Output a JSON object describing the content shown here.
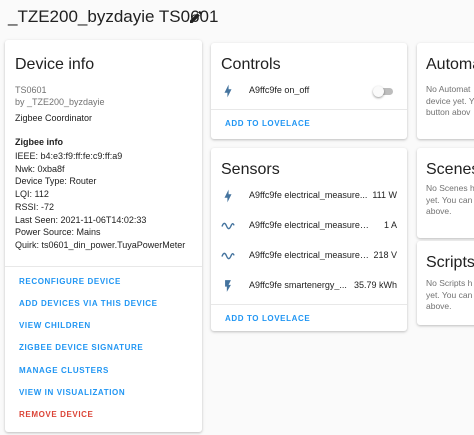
{
  "header": {
    "title": "_TZE200_byzdayie TS0601"
  },
  "device_info": {
    "title": "Device info",
    "model": "TS0601",
    "by": "by _TZE200_byzdayie",
    "coordinator": "Zigbee Coordinator",
    "zigbee_title": "Zigbee info",
    "zigbee_lines": [
      "IEEE: b4:e3:f9:ff:fe:c9:ff:a9",
      "Nwk: 0xba8f",
      "Device Type: Router",
      "LQI: 112",
      "RSSI: -72",
      "Last Seen: 2021-11-06T14:02:33",
      "Power Source: Mains",
      "Quirk: ts0601_din_power.TuyaPowerMeter"
    ],
    "actions": [
      "RECONFIGURE DEVICE",
      "ADD DEVICES VIA THIS DEVICE",
      "VIEW CHILDREN",
      "ZIGBEE DEVICE SIGNATURE",
      "MANAGE CLUSTERS",
      "VIEW IN VISUALIZATION",
      "REMOVE DEVICE"
    ]
  },
  "controls": {
    "title": "Controls",
    "entity": {
      "icon": "lightning-bolt-icon",
      "name": "A9ffc9fe on_off",
      "state": "off"
    },
    "add_label": "ADD TO LOVELACE"
  },
  "sensors": {
    "title": "Sensors",
    "rows": [
      {
        "icon": "lightning-bolt-icon",
        "name": "A9ffc9fe electrical_measure...",
        "value": "111 W"
      },
      {
        "icon": "sine-wave-icon",
        "name": "A9ffc9fe electrical_measureme...",
        "value": "1 A"
      },
      {
        "icon": "sine-wave-icon",
        "name": "A9ffc9fe electrical_measureme...",
        "value": "218 V"
      },
      {
        "icon": "flash-icon",
        "name": "A9ffc9fe smartenergy_...",
        "value": "35.79 kWh"
      }
    ],
    "add_label": "ADD TO LOVELACE"
  },
  "automations": {
    "title": "Automat",
    "text": [
      "No Automat",
      "device yet. Y",
      "button abov"
    ]
  },
  "scenes": {
    "title": "Scenes",
    "text": [
      "No Scenes h",
      "yet. You can",
      "above."
    ]
  },
  "scripts": {
    "title": "Scripts",
    "text": [
      "No Scripts h",
      "yet. You can",
      "above."
    ]
  },
  "colors": {
    "accent": "#2196f3",
    "danger": "#db4437",
    "icon": "#44739e"
  }
}
